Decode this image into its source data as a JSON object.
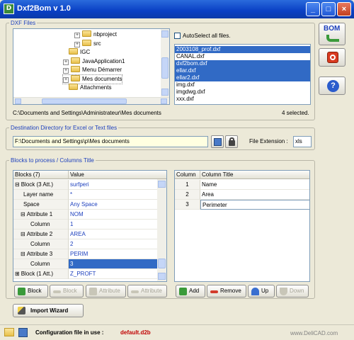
{
  "window": {
    "title": "Dxf2Bom v 1.0"
  },
  "dxf_files": {
    "legend": "DXF Files",
    "tree": [
      "nbproject",
      "src",
      "IGC",
      "JavaApplication1",
      "Menu Démarrer",
      "Mes documents",
      "Attachments"
    ],
    "autoselect_label": "AutoSelect all files.",
    "files": [
      {
        "name": "2003108_prof.dxf",
        "selected": true
      },
      {
        "name": "CANAL.dxf",
        "selected": false
      },
      {
        "name": "dxf2bom.dxf",
        "selected": true
      },
      {
        "name": "ellar.dxf",
        "selected": true
      },
      {
        "name": "ellar2.dxf",
        "selected": true
      },
      {
        "name": "img.dxf",
        "selected": false
      },
      {
        "name": "imgdwg.dxf",
        "selected": false
      },
      {
        "name": "xxx.dxf",
        "selected": false
      }
    ],
    "path": "C:\\Documents and Settings\\Administrateur\\Mes documents",
    "selected_count": "4 selected."
  },
  "destination": {
    "legend": "Destination Directory for Excel or Text files",
    "path": "F:\\Documents and Settings\\p\\Mes documents",
    "ext_label": "File Extension :",
    "ext_value": "xls"
  },
  "blocks": {
    "legend": "Blocks to process / Columns Title",
    "left_headers": [
      "Blocks (7)",
      "Value"
    ],
    "left_rows": [
      {
        "label": "Block (3 Att.)",
        "value": "surfperi",
        "expander": "⊟",
        "indent": 0
      },
      {
        "label": "Layer name",
        "value": "*",
        "expander": "",
        "indent": 1
      },
      {
        "label": "Space",
        "value": "Any Space",
        "expander": "",
        "indent": 1
      },
      {
        "label": "Attribute 1",
        "value": "NOM",
        "expander": "⊟",
        "indent": 1
      },
      {
        "label": "Column",
        "value": "1",
        "expander": "",
        "indent": 2
      },
      {
        "label": "Attribute 2",
        "value": "AREA",
        "expander": "⊟",
        "indent": 1
      },
      {
        "label": "Column",
        "value": "2",
        "expander": "",
        "indent": 2
      },
      {
        "label": "Attribute 3",
        "value": "PERIM",
        "expander": "⊟",
        "indent": 1
      },
      {
        "label": "Column",
        "value": "3",
        "expander": "",
        "indent": 2,
        "selected": true
      },
      {
        "label": "Block (1 Att.)",
        "value": "Z_PROFT",
        "expander": "⊞",
        "indent": 0
      }
    ],
    "right_headers": [
      "Column",
      "Column Title"
    ],
    "right_rows": [
      {
        "col": "1",
        "title": "Name"
      },
      {
        "col": "2",
        "title": "Area"
      },
      {
        "col": "3",
        "title": "Perimeter"
      }
    ],
    "left_buttons": [
      "Block",
      "Block",
      "Attribute",
      "Attribute"
    ],
    "right_buttons": [
      "Add",
      "Remove",
      "Up",
      "Down"
    ]
  },
  "import_wizard": "Import Wizard",
  "status": {
    "config_label": "Configuration file in use :",
    "config_file": "default.d2b",
    "website": "www.DeliCAD.com"
  },
  "side": {
    "bom_label": "BOM"
  },
  "colors": {
    "accent": "#1c3fbd",
    "selection": "#316ac5",
    "config_file": "#c00000"
  }
}
